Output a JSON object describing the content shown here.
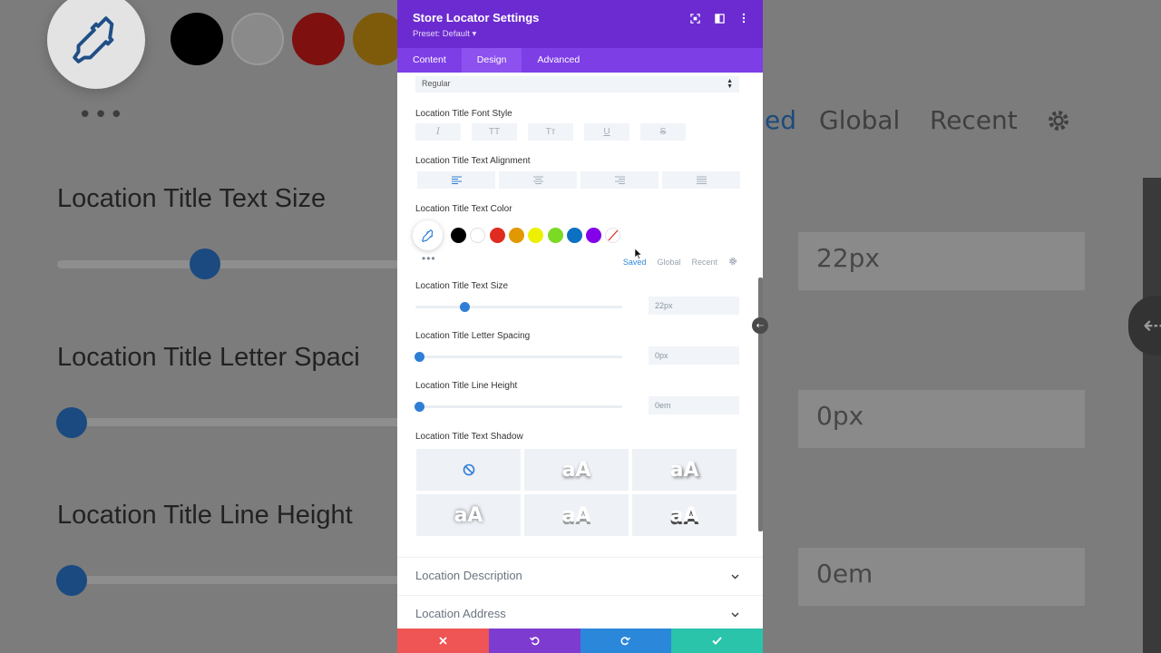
{
  "modal": {
    "title": "Store Locator Settings",
    "preset": "Preset: Default ▾",
    "tabs": [
      {
        "label": "Content",
        "active": false
      },
      {
        "label": "Design",
        "active": true
      },
      {
        "label": "Advanced",
        "active": false
      }
    ]
  },
  "fields": {
    "font_weight": "Regular",
    "font_style_label": "Location Title Font Style",
    "font_style_buttons": [
      "I",
      "TT",
      "Tт",
      "U",
      "S"
    ],
    "alignment_label": "Location Title Text Alignment",
    "alignment_options": [
      "left",
      "center",
      "right",
      "justify"
    ],
    "color_label": "Location Title Text Color",
    "color_swatches": [
      "#000000",
      "#ffffff",
      "#e02b20",
      "#e09900",
      "#edf000",
      "#7cda24",
      "#0c71c3",
      "#8300e9"
    ],
    "color_tabs": [
      "Saved",
      "Global",
      "Recent"
    ],
    "color_tab_active": "Saved",
    "text_size_label": "Location Title Text Size",
    "text_size_value": "22px",
    "text_size_level": 0.22,
    "letter_spacing_label": "Location Title Letter Spacing",
    "letter_spacing_value": "0px",
    "letter_spacing_level": 0,
    "line_height_label": "Location Title Line Height",
    "line_height_value": "0em",
    "line_height_level": 0,
    "text_shadow_label": "Location Title Text Shadow",
    "shadow_preset_text": "aA"
  },
  "accordions": [
    {
      "label": "Location Description"
    },
    {
      "label": "Location Address"
    }
  ],
  "footer": {
    "colors": {
      "cancel": "#ef5555",
      "undo": "#7e3bd0",
      "redo": "#2b87da",
      "save": "#29c4a9"
    }
  },
  "background": {
    "text_size_label": "Location Title Text Size",
    "letter_spacing_label": "Location Title Letter Spaci",
    "line_height_label": "Location Title Line Height",
    "text_size_value": "22px",
    "letter_spacing_value": "0px",
    "line_height_value": "0em",
    "tabs": [
      "ed",
      "Global",
      "Recent"
    ]
  }
}
